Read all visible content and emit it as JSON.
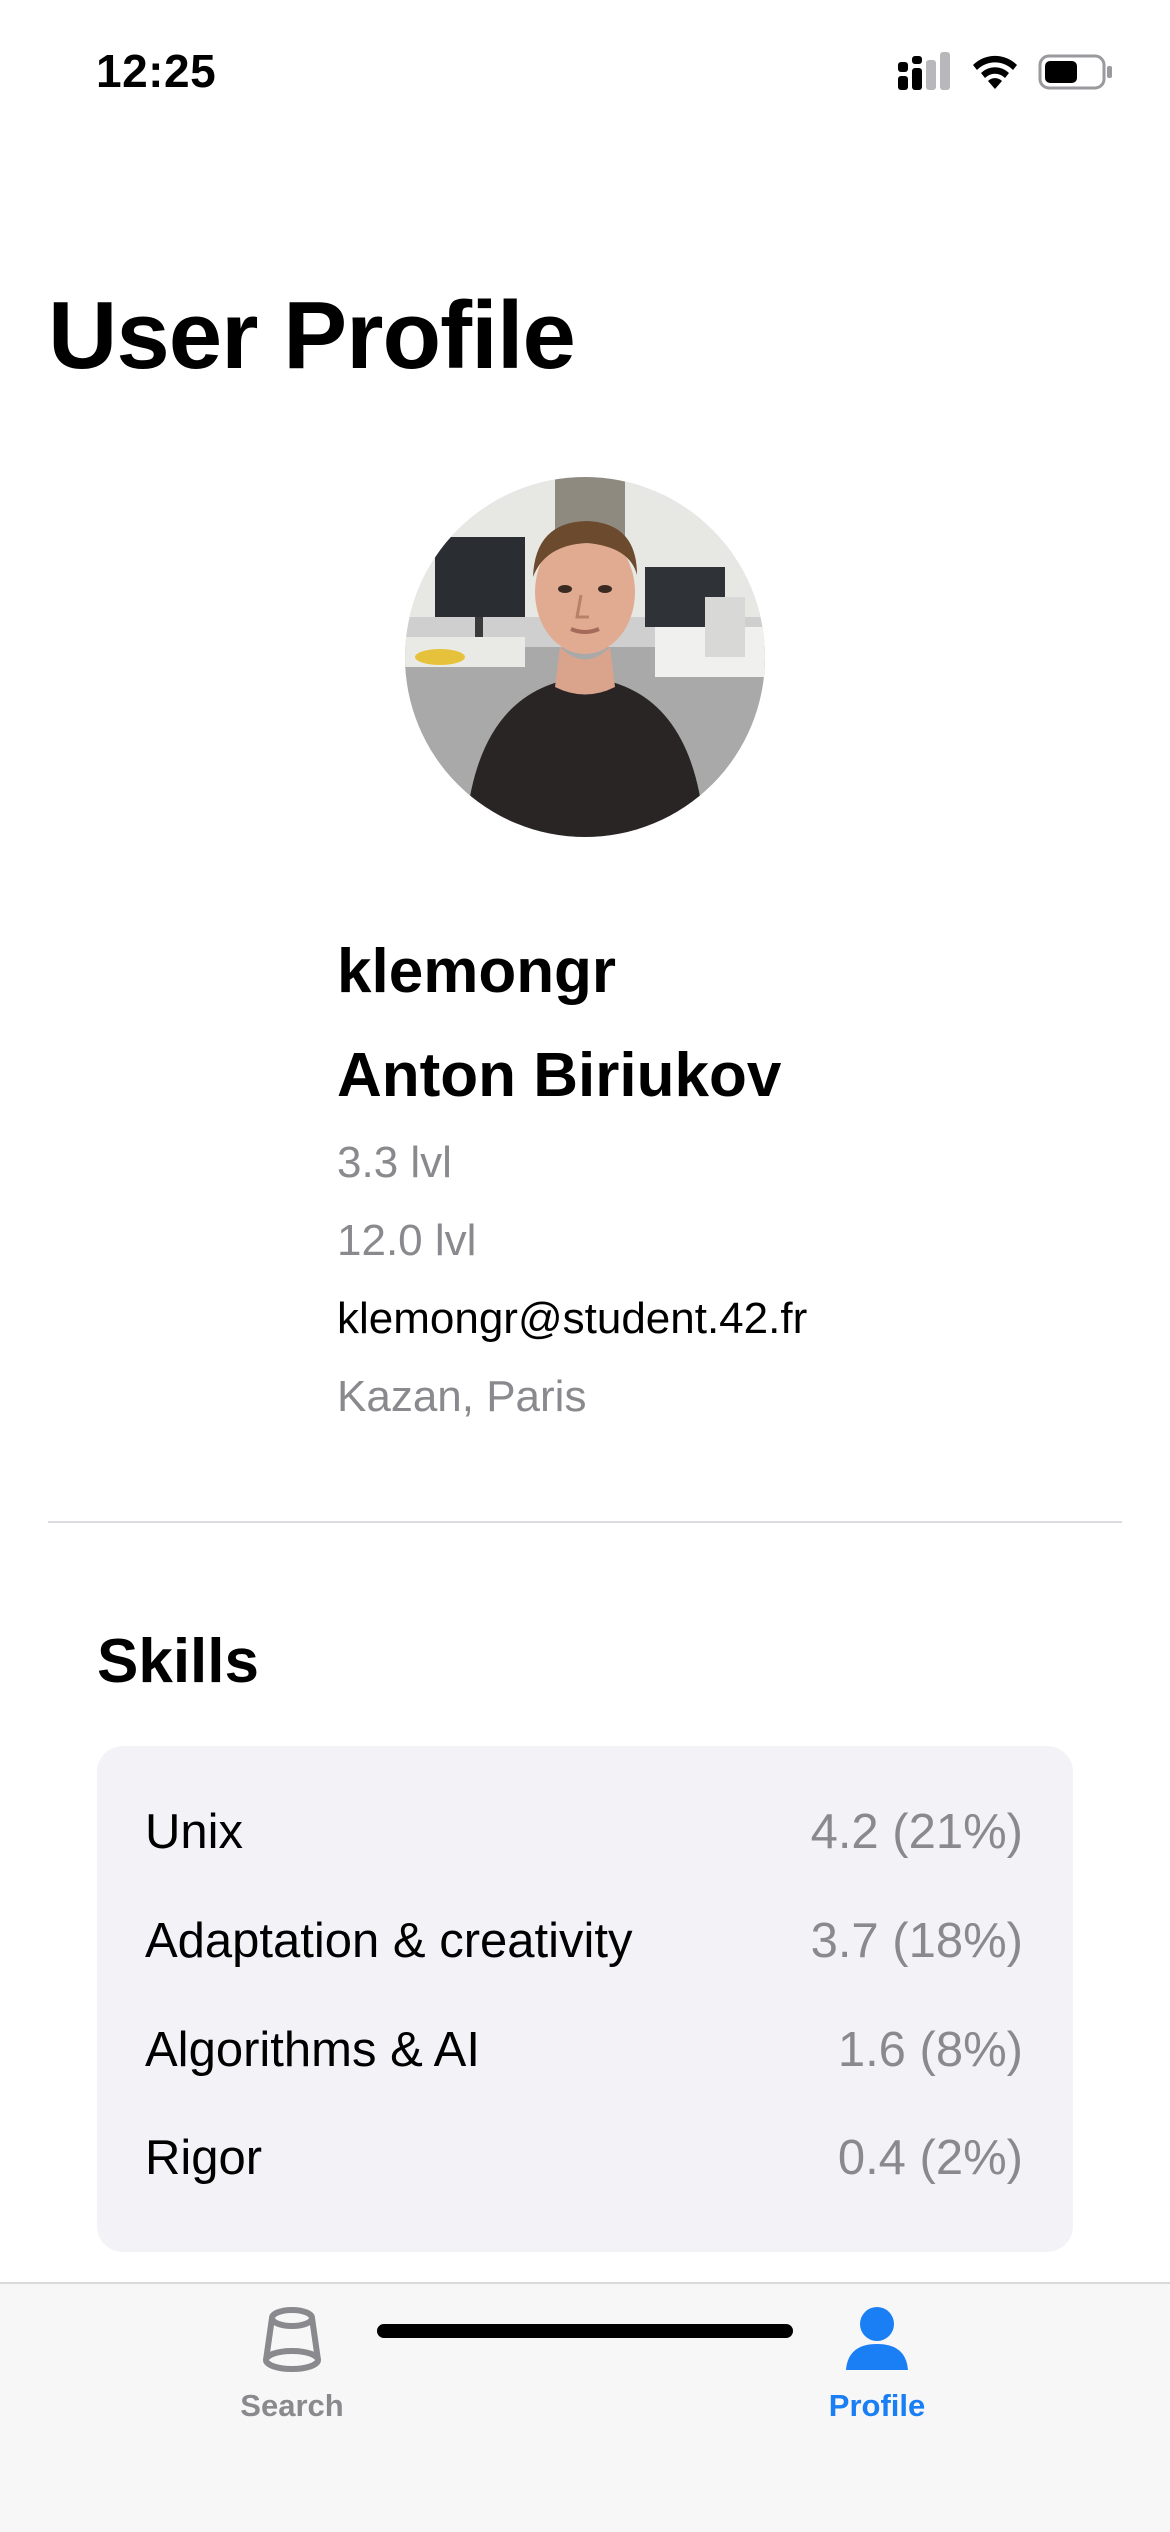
{
  "status_bar": {
    "time": "12:25"
  },
  "page": {
    "title": "User Profile"
  },
  "profile": {
    "login": "klemongr",
    "full_name": "Anton Biriukov",
    "level_1": "3.3 lvl",
    "level_2": "12.0 lvl",
    "email": "klemongr@student.42.fr",
    "location": "Kazan, Paris"
  },
  "skills": {
    "title": "Skills",
    "items": [
      {
        "name": "Unix",
        "value": "4.2 (21%)"
      },
      {
        "name": "Adaptation & creativity",
        "value": "3.7 (18%)"
      },
      {
        "name": "Algorithms & AI",
        "value": "1.6 (8%)"
      },
      {
        "name": "Rigor",
        "value": "0.4 (2%)"
      }
    ]
  },
  "tab_bar": {
    "tabs": [
      {
        "label": "Search",
        "icon": "search-tab-icon",
        "selected": false
      },
      {
        "label": "Profile",
        "icon": "person-icon",
        "selected": true
      }
    ]
  },
  "colors": {
    "accent": "#1a7ef5",
    "secondary_text": "#8a8a8e",
    "card_background": "#f2f2f7"
  }
}
